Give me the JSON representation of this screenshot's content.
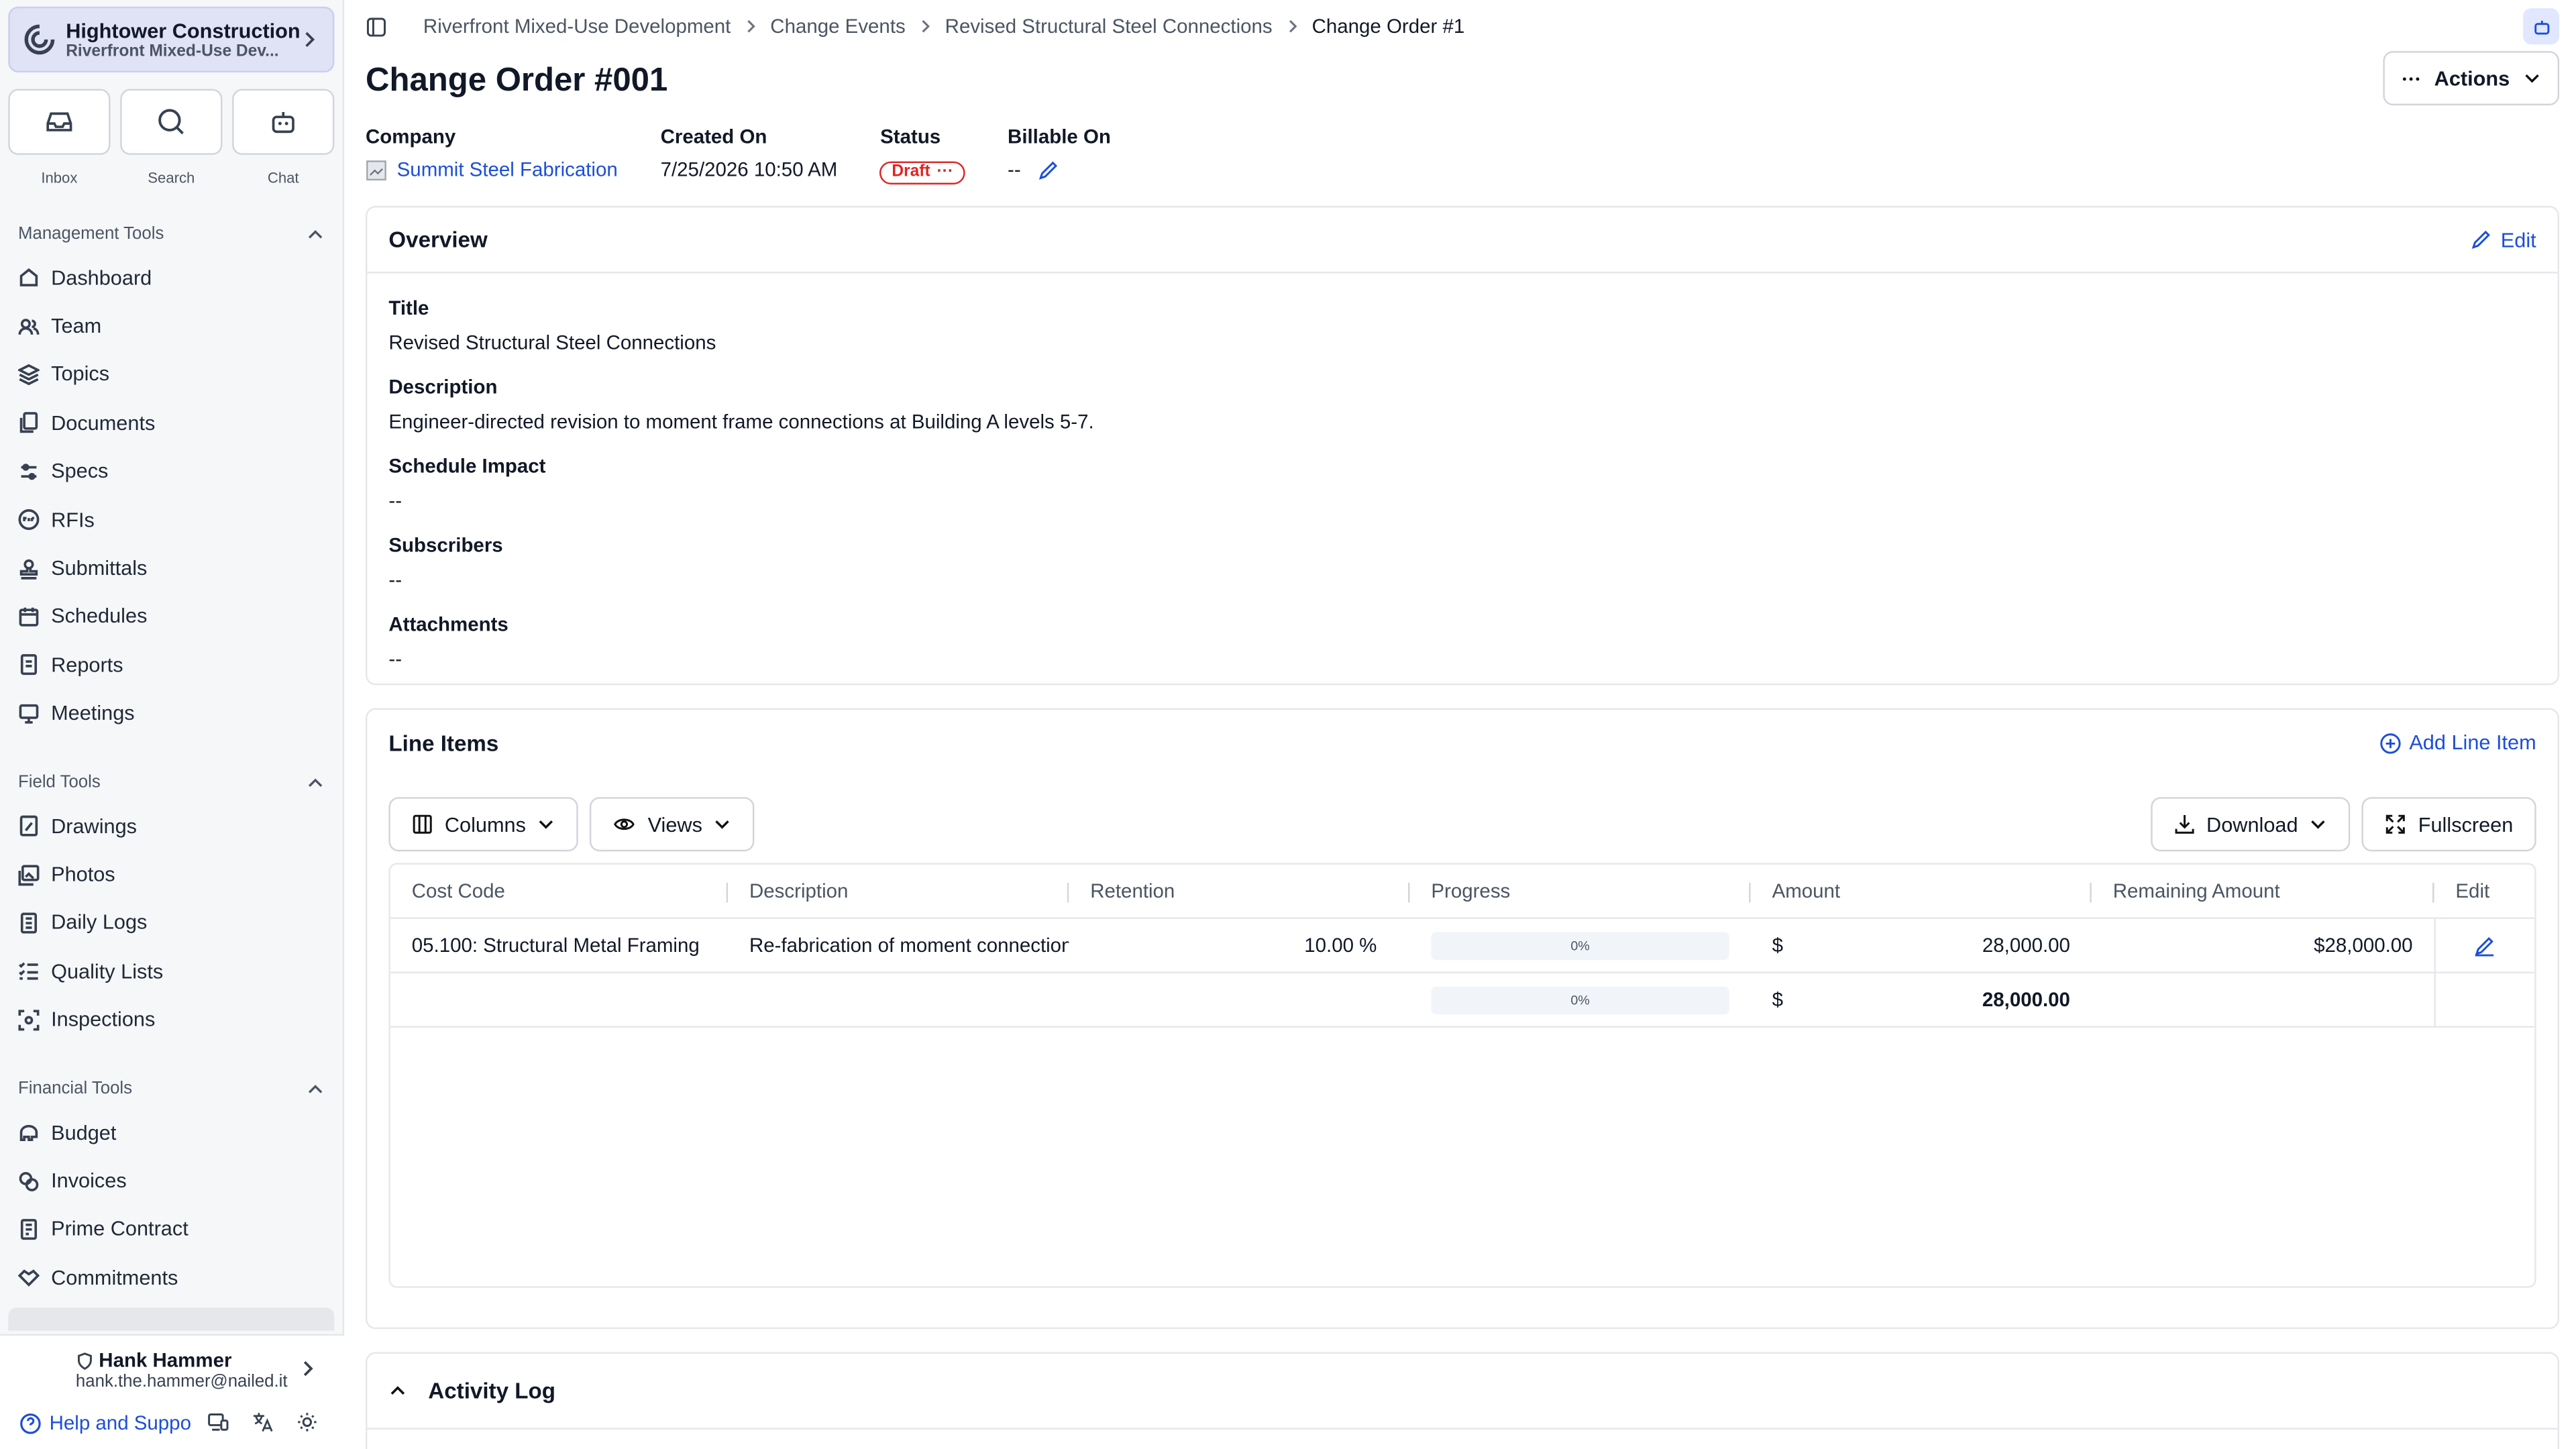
{
  "org": {
    "name": "Hightower Construction",
    "project": "Riverfront Mixed-Use Dev..."
  },
  "quick": {
    "inbox": "Inbox",
    "search": "Search",
    "chat": "Chat"
  },
  "sections": {
    "management": {
      "label": "Management Tools",
      "items": [
        "Dashboard",
        "Team",
        "Topics",
        "Documents",
        "Specs",
        "RFIs",
        "Submittals",
        "Schedules",
        "Reports",
        "Meetings"
      ]
    },
    "field": {
      "label": "Field Tools",
      "items": [
        "Drawings",
        "Photos",
        "Daily Logs",
        "Quality Lists",
        "Inspections"
      ]
    },
    "financial": {
      "label": "Financial Tools",
      "items": [
        "Budget",
        "Invoices",
        "Prime Contract",
        "Commitments"
      ]
    }
  },
  "user": {
    "name": "Hank Hammer",
    "email": "hank.the.hammer@nailed.it",
    "help": "Help and Suppo"
  },
  "breadcrumb": [
    "Riverfront Mixed-Use Development",
    "Change Events",
    "Revised Structural Steel Connections",
    "Change Order #1"
  ],
  "page": {
    "title": "Change Order #001",
    "actions": "Actions"
  },
  "meta": {
    "company_label": "Company",
    "company": "Summit Steel Fabrication",
    "created_label": "Created On",
    "created": "7/25/2026 10:50 AM",
    "status_label": "Status",
    "status": "Draft",
    "billable_label": "Billable On",
    "billable": "--"
  },
  "overview": {
    "heading": "Overview",
    "edit": "Edit",
    "fields": [
      {
        "label": "Title",
        "value": "Revised Structural Steel Connections"
      },
      {
        "label": "Description",
        "value": "Engineer-directed revision to moment frame connections at Building A levels 5-7."
      },
      {
        "label": "Schedule Impact",
        "value": "--"
      },
      {
        "label": "Subscribers",
        "value": "--"
      },
      {
        "label": "Attachments",
        "value": "--"
      }
    ]
  },
  "line_items": {
    "heading": "Line Items",
    "add": "Add Line Item",
    "columns_btn": "Columns",
    "views_btn": "Views",
    "download_btn": "Download",
    "fullscreen_btn": "Fullscreen",
    "headers": [
      "Cost Code",
      "Description",
      "Retention",
      "Progress",
      "Amount",
      "Remaining Amount",
      "Edit"
    ],
    "row": {
      "cost_code": "05.100: Structural Metal Framing",
      "description": "Re-fabrication of moment connection",
      "retention": "10.00 %",
      "progress": "0%",
      "currency": "$",
      "amount": "28,000.00",
      "remaining": "$28,000.00"
    },
    "total": {
      "progress": "0%",
      "currency": "$",
      "amount": "28,000.00"
    }
  },
  "activity": {
    "heading": "Activity Log"
  }
}
